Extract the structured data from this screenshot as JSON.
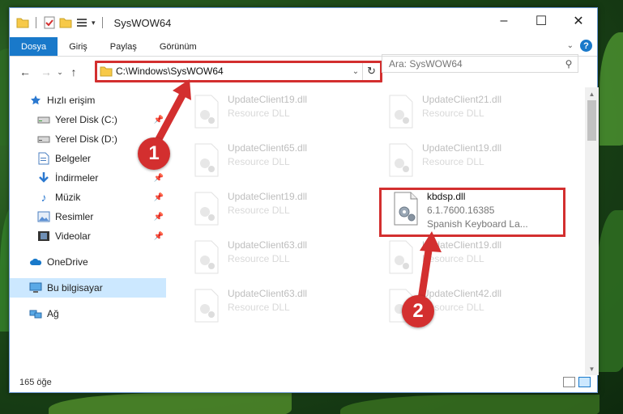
{
  "window": {
    "title": "SysWOW64"
  },
  "ribbon": {
    "tabs": [
      "Dosya",
      "Giriş",
      "Paylaş",
      "Görünüm"
    ],
    "help": "?"
  },
  "nav": {
    "address_path": "C:\\Windows\\SysWOW64",
    "search_placeholder": "Ara: SysWOW64"
  },
  "sidebar": {
    "items": [
      {
        "label": "Hızlı erişim",
        "icon": "star-icon",
        "pinned": false
      },
      {
        "label": "Yerel Disk (C:)",
        "icon": "drive-icon",
        "pinned": true
      },
      {
        "label": "Yerel Disk (D:)",
        "icon": "drive-icon",
        "pinned": true
      },
      {
        "label": "Belgeler",
        "icon": "documents-icon",
        "pinned": true
      },
      {
        "label": "İndirmeler",
        "icon": "download-icon",
        "pinned": true
      },
      {
        "label": "Müzik",
        "icon": "music-icon",
        "pinned": true
      },
      {
        "label": "Resimler",
        "icon": "pictures-icon",
        "pinned": true
      },
      {
        "label": "Videolar",
        "icon": "video-icon",
        "pinned": true
      },
      {
        "label": "OneDrive",
        "icon": "cloud-icon",
        "pinned": false
      },
      {
        "label": "Bu bilgisayar",
        "icon": "computer-icon",
        "pinned": false
      },
      {
        "label": "Ağ",
        "icon": "network-icon",
        "pinned": false
      }
    ]
  },
  "files": [
    {
      "name": "UpdateClient19.dll",
      "desc": "Resource DLL"
    },
    {
      "name": "UpdateClient21.dll",
      "desc": "Resource DLL"
    },
    {
      "name": "UpdateClient65.dll",
      "desc": "Resource DLL"
    },
    {
      "name": "UpdateClient19.dll",
      "desc": "Resource DLL"
    },
    {
      "name": "UpdateClient19.dll",
      "desc": "Resource DLL"
    },
    {
      "name": "kbdsp.dll",
      "desc": "6.1.7600.16385",
      "desc2": "Spanish Keyboard La..."
    },
    {
      "name": "UpdateClient63.dll",
      "desc": "Resource DLL"
    },
    {
      "name": "UpdateClient19.dll",
      "desc": "Resource DLL"
    },
    {
      "name": "UpdateClient63.dll",
      "desc": "Resource DLL"
    },
    {
      "name": "UpdateClient42.dll",
      "desc": "Resource DLL"
    }
  ],
  "status": {
    "count": "165 öğe"
  },
  "annotations": {
    "step1": "1",
    "step2": "2",
    "color": "#d32f2f"
  }
}
